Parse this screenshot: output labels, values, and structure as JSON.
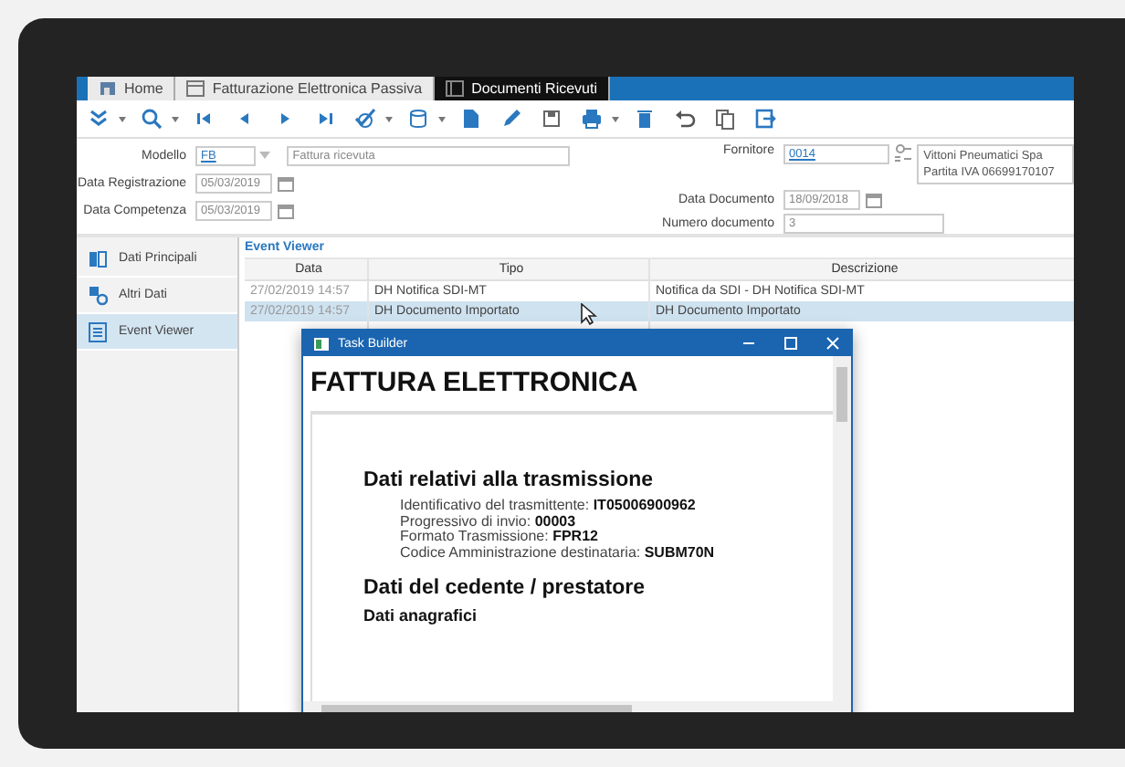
{
  "tabs": [
    {
      "label": "Home",
      "selected": false
    },
    {
      "label": "Fatturazione Elettronica Passiva",
      "selected": false
    },
    {
      "label": "Documenti Ricevuti",
      "selected": true
    }
  ],
  "toolbar": [
    {
      "kind": "expand",
      "dropdown": true
    },
    {
      "kind": "search",
      "dropdown": true
    },
    {
      "kind": "first",
      "dropdown": false
    },
    {
      "kind": "prev",
      "dropdown": false
    },
    {
      "kind": "next",
      "dropdown": false
    },
    {
      "kind": "last",
      "dropdown": false
    },
    {
      "kind": "check",
      "dropdown": true
    },
    {
      "kind": "database",
      "dropdown": true
    },
    {
      "kind": "new",
      "dropdown": false
    },
    {
      "kind": "edit",
      "dropdown": false
    },
    {
      "kind": "save",
      "dropdown": false
    },
    {
      "kind": "print",
      "dropdown": true
    },
    {
      "kind": "delete",
      "dropdown": false
    },
    {
      "kind": "undo",
      "dropdown": false
    },
    {
      "kind": "copy",
      "dropdown": false
    },
    {
      "kind": "exit",
      "dropdown": false
    }
  ],
  "form": {
    "left": [
      {
        "label": "Modello",
        "kind": "lookup",
        "value": "FB",
        "description": "Fattura ricevuta"
      },
      {
        "label": "Data Registrazione",
        "kind": "date",
        "value": "05/03/2019"
      },
      {
        "label": "Data Competenza",
        "kind": "date",
        "value": "05/03/2019"
      }
    ],
    "right": [
      {
        "label": "Fornitore",
        "kind": "supplier",
        "value": "0014",
        "details": [
          "Vittoni Pneumatici Spa",
          "Partita IVA 06699170107"
        ]
      },
      {
        "label": "Data Documento",
        "kind": "date",
        "value": "18/09/2018"
      },
      {
        "label": "Numero documento",
        "kind": "text",
        "value": "3"
      }
    ]
  },
  "sidebar": {
    "items": [
      {
        "label": "Dati Principali",
        "selected": false
      },
      {
        "label": "Altri Dati",
        "selected": false
      },
      {
        "label": "Event Viewer",
        "selected": true
      }
    ]
  },
  "event_viewer": {
    "title": "Event Viewer",
    "columns": [
      "Data",
      "Tipo",
      "Descrizione"
    ],
    "rows": [
      {
        "cells": [
          "27/02/2019 14:57",
          "DH Notifica SDI-MT",
          "Notifica da SDI - DH Notifica SDI-MT"
        ],
        "selected": false
      },
      {
        "cells": [
          "27/02/2019 14:57",
          "DH Documento Importato",
          "DH Documento Importato"
        ],
        "selected": true
      }
    ]
  },
  "task_builder": {
    "title": "Task Builder",
    "heading": "FATTURA ELETTRONICA",
    "sections": [
      {
        "title": "Dati relativi alla trasmissione",
        "kind": "h2",
        "lines": [
          "Identificativo del trasmittente: **IT05006900962**",
          "Progressivo di invio: **00003**",
          "Formato Trasmissione: **FPR12**",
          "Codice Amministrazione destinataria: **SUBM70N**"
        ]
      },
      {
        "title": "Dati del cedente / prestatore",
        "kind": "h2"
      },
      {
        "title": "Dati anagrafici",
        "kind": "h3"
      }
    ]
  }
}
